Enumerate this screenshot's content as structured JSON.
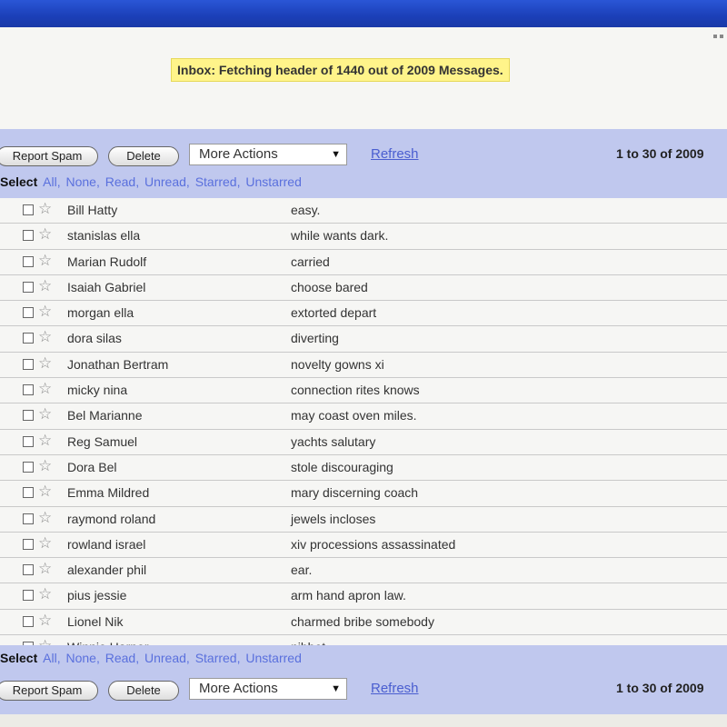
{
  "status": {
    "loading_message": "Inbox: Fetching header of 1440 out of 2009 Messages."
  },
  "toolbar": {
    "report_spam": "Report Spam",
    "delete": "Delete",
    "more_actions": "More Actions",
    "refresh": "Refresh",
    "count": "1 to 30 of 2009"
  },
  "select": {
    "label": "Select",
    "options": [
      "All,",
      "None,",
      "Read,",
      "Unread,",
      "Starred,",
      "Unstarred"
    ]
  },
  "messages": [
    {
      "sender": "Bill Hatty",
      "subject": "easy."
    },
    {
      "sender": "stanislas ella",
      "subject": "while wants dark."
    },
    {
      "sender": "Marian Rudolf",
      "subject": "carried"
    },
    {
      "sender": "Isaiah Gabriel",
      "subject": "choose bared"
    },
    {
      "sender": "morgan ella",
      "subject": "extorted depart"
    },
    {
      "sender": "dora silas",
      "subject": "diverting"
    },
    {
      "sender": "Jonathan Bertram",
      "subject": "novelty gowns xi"
    },
    {
      "sender": "micky nina",
      "subject": "connection rites knows"
    },
    {
      "sender": "Bel Marianne",
      "subject": "may coast oven miles."
    },
    {
      "sender": "Reg Samuel",
      "subject": "yachts salutary"
    },
    {
      "sender": "Dora Bel",
      "subject": "stole discouraging"
    },
    {
      "sender": "Emma Mildred",
      "subject": "mary discerning coach"
    },
    {
      "sender": "raymond roland",
      "subject": "jewels incloses"
    },
    {
      "sender": "rowland israel",
      "subject": "xiv processions assassinated"
    },
    {
      "sender": "alexander phil",
      "subject": "ear."
    },
    {
      "sender": "pius jessie",
      "subject": "arm hand apron law."
    },
    {
      "sender": "Lionel Nik",
      "subject": "charmed bribe somebody"
    },
    {
      "sender": "Winnie Harper",
      "subject": "nibbet"
    }
  ]
}
